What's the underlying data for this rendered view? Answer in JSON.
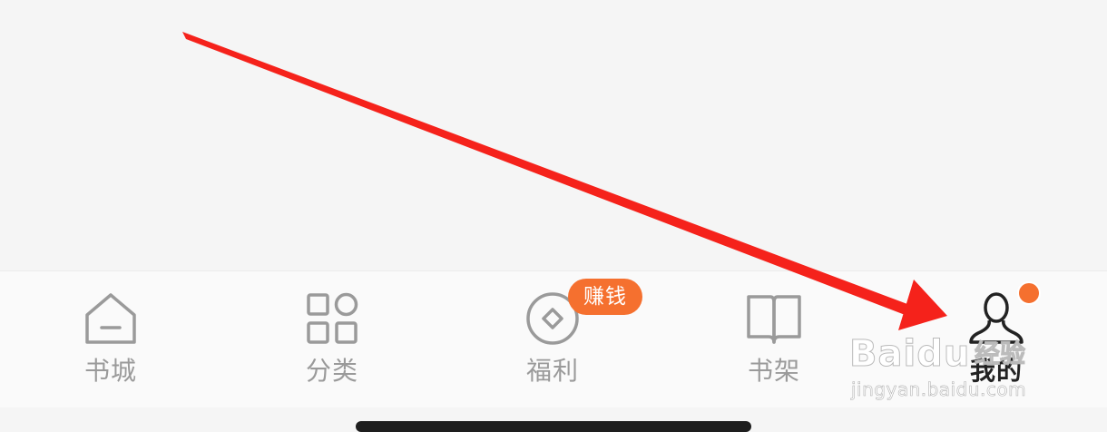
{
  "tabbar": {
    "tabs": [
      {
        "id": "bookstore",
        "label": "书城",
        "icon": "home-icon",
        "active": false
      },
      {
        "id": "category",
        "label": "分类",
        "icon": "grid-icon",
        "active": false
      },
      {
        "id": "welfare",
        "label": "福利",
        "icon": "coin-icon",
        "active": false
      },
      {
        "id": "bookshelf",
        "label": "书架",
        "icon": "book-icon",
        "active": false
      },
      {
        "id": "mine",
        "label": "我的",
        "icon": "user-icon",
        "active": true
      }
    ]
  },
  "badges": {
    "welfare": {
      "text": "赚钱",
      "color": "#f5702f"
    },
    "mine_dot": {
      "color": "#f5702f"
    }
  },
  "annotation": {
    "color": "#f5221b",
    "target": "tab-mine"
  },
  "watermark": {
    "brand": "Baidu",
    "product": "经验",
    "url": "jingyan.baidu.com"
  },
  "colors": {
    "inactive": "#9a9a9a",
    "active": "#222222",
    "background": "#f5f5f5",
    "tabbar_background": "#fafafa"
  }
}
